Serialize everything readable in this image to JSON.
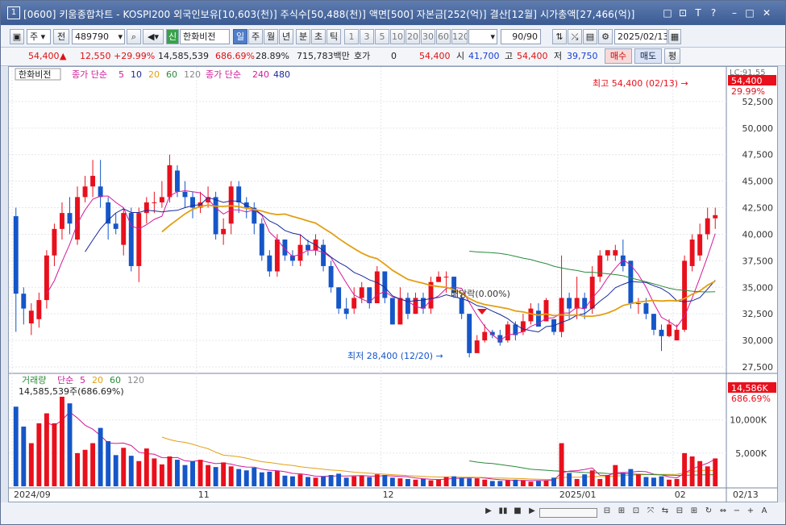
{
  "window": {
    "number": "1",
    "title": "[0600] 키움종합차트 - KOSPI200 외국인보유[10,603(천)] 주식수[50,488(천)] 액면[500] 자본금[252(억)] 결산[12월] 시가총액[27,466(억)]",
    "buttons": [
      "□",
      "⊡",
      "T",
      "?",
      "–",
      "□",
      "✕"
    ]
  },
  "toolbar": {
    "period_select": "주",
    "prev": "전",
    "code": "489790",
    "shin": "신",
    "name": "한화비전",
    "tf": [
      "일",
      "주",
      "월",
      "년",
      "분",
      "초",
      "틱"
    ],
    "tf_active": "일",
    "nums": [
      "1",
      "3",
      "5",
      "10",
      "20",
      "30",
      "60",
      "120"
    ],
    "count": "90/90",
    "date": "2025/02/13"
  },
  "quote": {
    "price": "54,400",
    "arrow": "▲",
    "change": "12,550",
    "pct": "+29.99%",
    "volume": "14,585,539",
    "vol_pct": "686.69%",
    "turnover": "28.89%",
    "amount": "715,783백만",
    "hoga_label": "호가",
    "hoga": "0",
    "ask": "54,400",
    "open_label": "시",
    "open": "41,700",
    "high_label": "고",
    "high": "54,400",
    "low_label": "저",
    "low": "39,750",
    "buy": "매수",
    "sell": "매도",
    "flat": "평"
  },
  "price_legend": {
    "name": "한화비전",
    "ma_label": "종가 단순",
    "periods": [
      "5",
      "10",
      "20",
      "60",
      "120"
    ],
    "ma2_label": "종가 단순",
    "periods2": [
      "240",
      "480"
    ]
  },
  "vol_legend": {
    "label": "거래량",
    "ma_label": "단순",
    "periods": [
      "5",
      "20",
      "60",
      "120"
    ],
    "value": "14,585,539주(686.69%)"
  },
  "annotations": {
    "high": "최고 54,400 (02/13)",
    "low": "최저 28,400 (12/20)",
    "div": "배당락(0.00%)",
    "lc": "LC:91.55",
    "price_tag": "54,400",
    "pct_tag": "29.99%",
    "vol_tag": "14,586K",
    "vol_pct_tag": "686.69%"
  },
  "colors": {
    "up": "#e8101c",
    "down": "#1556c8",
    "ma5": "#d21a9a",
    "ma10": "#1a2a9a",
    "ma20": "#e3a012",
    "ma60": "#2a8a3a"
  },
  "chart_data": {
    "type": "candlestick",
    "ylim": [
      27500,
      55000
    ],
    "yticks": [
      "52,500",
      "50,000",
      "47,500",
      "45,000",
      "42,500",
      "40,000",
      "37,500",
      "35,000",
      "32,500",
      "30,000",
      "27,500"
    ],
    "vol_yticks": [
      "10,000K",
      "5,000K"
    ],
    "xticks": [
      "2024/09",
      "11",
      "12",
      "2025/01",
      "02"
    ],
    "x_right": "02/13",
    "candles": [
      [
        41700,
        34400,
        42500,
        30800,
        12000
      ],
      [
        34400,
        33000,
        35000,
        31500,
        9000
      ],
      [
        31600,
        32800,
        33500,
        30500,
        6500
      ],
      [
        32000,
        33800,
        34500,
        31200,
        9500
      ],
      [
        33800,
        38000,
        38500,
        33000,
        11000
      ],
      [
        38000,
        40500,
        41000,
        37000,
        9500
      ],
      [
        40500,
        42000,
        43000,
        39500,
        13500
      ],
      [
        42000,
        41000,
        43500,
        40000,
        12500
      ],
      [
        39500,
        43500,
        44500,
        39000,
        5000
      ],
      [
        43500,
        44500,
        45500,
        43000,
        5500
      ],
      [
        44500,
        45500,
        47000,
        43500,
        6500
      ],
      [
        44500,
        43500,
        47000,
        42500,
        8800
      ],
      [
        43000,
        41000,
        43500,
        39500,
        6800
      ],
      [
        41000,
        40500,
        42000,
        40000,
        4700
      ],
      [
        39000,
        42000,
        42500,
        38000,
        5800
      ],
      [
        42000,
        37000,
        42500,
        36500,
        4600
      ],
      [
        37000,
        42000,
        42500,
        35500,
        3800
      ],
      [
        42000,
        43000,
        43500,
        41000,
        5700
      ],
      [
        43000,
        43000,
        44000,
        42000,
        4200
      ],
      [
        43000,
        43500,
        45000,
        42500,
        3300
      ],
      [
        43500,
        46500,
        47500,
        43000,
        4500
      ],
      [
        46000,
        44000,
        46500,
        43500,
        4000
      ],
      [
        44000,
        43500,
        45000,
        42500,
        3200
      ],
      [
        43500,
        42500,
        44000,
        41500,
        3800
      ],
      [
        42500,
        43000,
        44000,
        42000,
        4000
      ],
      [
        43000,
        43500,
        44500,
        42500,
        3200
      ],
      [
        43500,
        40000,
        44000,
        39500,
        2900
      ],
      [
        40000,
        40500,
        41500,
        39000,
        3600
      ],
      [
        41000,
        44500,
        45000,
        40000,
        3000
      ],
      [
        44500,
        43000,
        45000,
        42000,
        2600
      ],
      [
        43000,
        42500,
        43500,
        41500,
        2400
      ],
      [
        42500,
        41000,
        43000,
        40000,
        2800
      ],
      [
        41000,
        38000,
        41500,
        37500,
        2100
      ],
      [
        38000,
        36500,
        38500,
        36000,
        2200
      ],
      [
        36500,
        39500,
        40000,
        36000,
        2300
      ],
      [
        39500,
        38000,
        39500,
        37500,
        1600
      ],
      [
        38000,
        37500,
        38500,
        37000,
        1500
      ],
      [
        37500,
        39000,
        40000,
        37000,
        1800
      ],
      [
        39000,
        38500,
        39500,
        38000,
        1400
      ],
      [
        38500,
        39500,
        40000,
        38000,
        1300
      ],
      [
        39000,
        37000,
        39500,
        36500,
        1500
      ],
      [
        37000,
        35000,
        37500,
        34500,
        1700
      ],
      [
        35000,
        33000,
        35000,
        32500,
        1900
      ],
      [
        33000,
        32500,
        34000,
        32000,
        1300
      ],
      [
        33000,
        34000,
        35000,
        32500,
        1500
      ],
      [
        34000,
        35000,
        35500,
        33500,
        1600
      ],
      [
        35000,
        33500,
        35000,
        33000,
        1400
      ],
      [
        33500,
        36500,
        37000,
        33500,
        1800
      ],
      [
        36500,
        34000,
        36500,
        33500,
        1700
      ],
      [
        34000,
        31500,
        34000,
        31500,
        1300
      ],
      [
        31500,
        34000,
        35000,
        31500,
        1200
      ],
      [
        34000,
        32500,
        34500,
        32000,
        1100
      ],
      [
        32500,
        34000,
        34500,
        32500,
        1000
      ],
      [
        34000,
        33000,
        34500,
        32500,
        1100
      ],
      [
        33000,
        35500,
        36000,
        32500,
        900
      ],
      [
        35500,
        36000,
        36500,
        35500,
        1000
      ],
      [
        36000,
        36000,
        36500,
        34500,
        1400
      ],
      [
        36000,
        34500,
        36000,
        34000,
        1500
      ],
      [
        34000,
        32500,
        34500,
        32000,
        1300
      ],
      [
        32500,
        28800,
        32500,
        28400,
        1200
      ],
      [
        28800,
        30000,
        30500,
        29000,
        1200
      ],
      [
        30000,
        30800,
        31500,
        29800,
        1000
      ],
      [
        30800,
        30500,
        31000,
        30200,
        800
      ],
      [
        30500,
        29800,
        31000,
        29500,
        800
      ],
      [
        30000,
        31500,
        31800,
        29800,
        900
      ],
      [
        31500,
        30500,
        31800,
        30000,
        1000
      ],
      [
        30800,
        31800,
        32500,
        30500,
        900
      ],
      [
        31800,
        33000,
        33500,
        31500,
        700
      ],
      [
        32800,
        31300,
        33500,
        31300,
        800
      ],
      [
        31800,
        33800,
        34000,
        31800,
        900
      ],
      [
        32000,
        30800,
        32000,
        30500,
        1300
      ],
      [
        30800,
        34000,
        38000,
        30300,
        6500
      ],
      [
        34000,
        33000,
        34500,
        32000,
        2000
      ],
      [
        33000,
        34000,
        36000,
        32000,
        1100
      ],
      [
        34000,
        33000,
        34500,
        32000,
        1800
      ],
      [
        33000,
        36000,
        37000,
        32500,
        2400
      ],
      [
        36000,
        38000,
        38500,
        35500,
        1100
      ],
      [
        38000,
        38500,
        38500,
        37500,
        1700
      ],
      [
        38000,
        38500,
        39000,
        37500,
        3200
      ],
      [
        38000,
        37000,
        39500,
        36500,
        2000
      ],
      [
        37500,
        33500,
        37500,
        33000,
        2600
      ],
      [
        33500,
        33500,
        34000,
        32500,
        1800
      ],
      [
        33500,
        32500,
        34000,
        32000,
        1400
      ],
      [
        32500,
        31000,
        32500,
        30500,
        1300
      ],
      [
        31000,
        30400,
        31500,
        29000,
        1500
      ],
      [
        30400,
        31500,
        32000,
        30300,
        1000
      ],
      [
        30000,
        31000,
        31500,
        30000,
        1100
      ],
      [
        31000,
        37500,
        38000,
        30800,
        5000
      ],
      [
        37000,
        39500,
        40000,
        36500,
        4500
      ],
      [
        38000,
        40000,
        41000,
        37500,
        3800
      ],
      [
        40000,
        41500,
        42500,
        39500,
        3000
      ],
      [
        41500,
        41800,
        42500,
        40500,
        4200
      ]
    ]
  }
}
